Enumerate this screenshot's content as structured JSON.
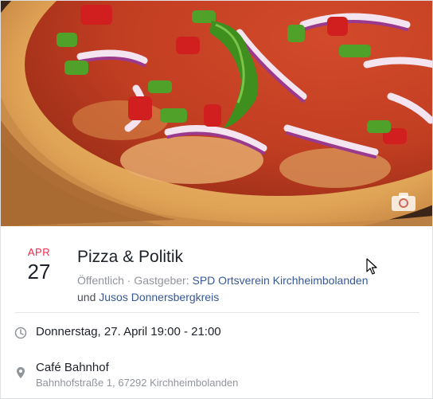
{
  "event": {
    "month": "APR",
    "day": "27",
    "title": "Pizza & Politik",
    "visibility": "Öffentlich",
    "separator": " · ",
    "host_prefix": "Gastgeber: ",
    "host_1": "SPD Ortsverein Kirchheimbolanden",
    "host_joiner": "und ",
    "host_2": "Jusos Donnersbergkreis"
  },
  "details": {
    "datetime": "Donnerstag, 27. April 19:00 - 21:00",
    "location_name": "Café Bahnhof",
    "location_address": "Bahnhofstraße 1, 67292 Kirchheimbolanden"
  },
  "icons": {
    "cover": "camera-icon",
    "time": "clock-icon",
    "location": "map-pin-icon"
  },
  "colors": {
    "month": "#f02849",
    "link": "#365899",
    "muted": "#90949c"
  }
}
